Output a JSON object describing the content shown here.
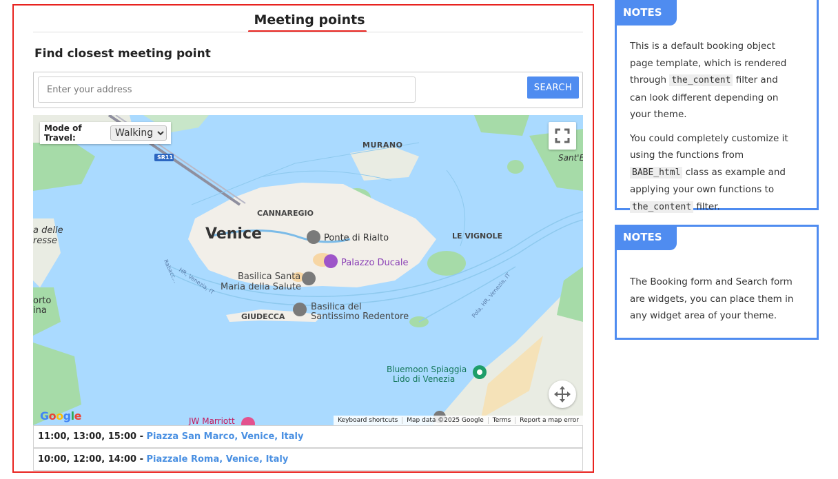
{
  "main": {
    "title": "Meeting points",
    "section_heading": "Find closest meeting point",
    "search": {
      "placeholder": "Enter your address",
      "button_label": "SEARCH"
    },
    "map": {
      "travel_label": "Mode of Travel:",
      "travel_selected": "Walking",
      "travel_options": [
        "Walking"
      ],
      "labels": {
        "murano": "MURANO",
        "sant_e": "Sant'E",
        "sr11": "SR11",
        "venice": "Venice",
        "cannaregio": "CANNAREGIO",
        "ponte": "Ponte di Rialto",
        "le_vignole": "LE VIGNOLE",
        "ducale": "Palazzo Ducale",
        "delle_1": "a delle",
        "delle_2": "resse",
        "basilica_santa": "Basilica Santa",
        "maria": "Maria della Salute",
        "orto": "orto",
        "ina": "ina",
        "giudecca": "GIUDECCA",
        "redentore_1": "Basilica del",
        "redentore_2": "Santissimo Redentore",
        "bluemoon_1": "Bluemoon Spiaggia",
        "bluemoon_2": "Lido di Venezia",
        "jw": "JW Marriott",
        "road_rabacc": "Rabacc...",
        "road_hr": "HR, Venezia, IT",
        "road_pola": "Pola, HR, Venezia, IT"
      },
      "google_logo": "Google",
      "footer": {
        "keyboard": "Keyboard shortcuts",
        "map_data": "Map data ©2025 Google",
        "terms": "Terms",
        "report": "Report a map error"
      }
    },
    "meeting_points": [
      {
        "times": "11:00, 13:00, 15:00 - ",
        "place": "Piazza San Marco, Venice, Italy"
      },
      {
        "times": "10:00, 12:00, 14:00 - ",
        "place": "Piazzale Roma, Venice, Italy"
      }
    ]
  },
  "sidebar": {
    "notes1": {
      "title": "NOTES",
      "p1_before": "This is a default booking object page template, which is rendered through ",
      "p1_code": "the_content",
      "p1_after": " filter and can look different depending on your theme.",
      "p2_before": "You could completely customize it using the functions from ",
      "p2_code1": "BABE_html",
      "p2_mid": " class as example and applying your own functions to ",
      "p2_code2": "the_content",
      "p2_after": " filter."
    },
    "notes2": {
      "title": "NOTES",
      "text": "The Booking form and Search form are widgets, you can place them in any widget area of your theme."
    }
  },
  "colors": {
    "accent": "#4f8cf0",
    "highlight": "#e8231f",
    "link": "#4a90e2",
    "water": "#aadaff"
  }
}
